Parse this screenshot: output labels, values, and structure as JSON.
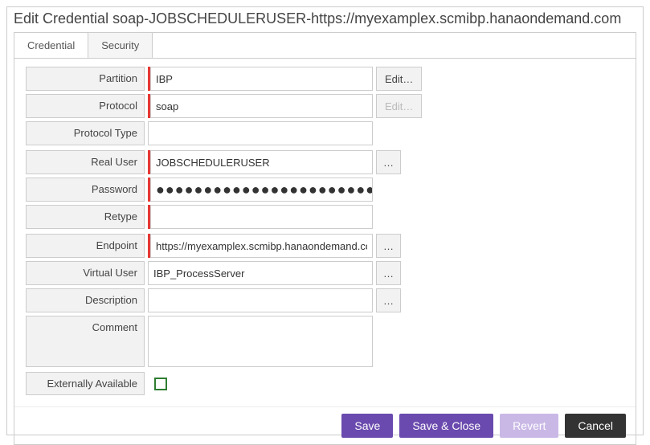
{
  "title": "Edit Credential soap-JOBSCHEDULERUSER-https://myexamplex.scmibp.hanaondemand.com",
  "tabs": {
    "credential": "Credential",
    "security": "Security"
  },
  "labels": {
    "partition": "Partition",
    "protocol": "Protocol",
    "protocolType": "Protocol Type",
    "realUser": "Real User",
    "password": "Password",
    "retype": "Retype",
    "endpoint": "Endpoint",
    "virtualUser": "Virtual User",
    "description": "Description",
    "comment": "Comment",
    "externallyAvailable": "Externally Available"
  },
  "fields": {
    "partition": "IBP",
    "protocol": "soap",
    "protocolType": "",
    "realUser": "JOBSCHEDULERUSER",
    "password": "●●●●●●●●●●●●●●●●●●●●●●●●●●●●●●●●",
    "retype": "",
    "endpoint": "https://myexamplex.scmibp.hanaondemand.com",
    "virtualUser": "IBP_ProcessServer",
    "description": "",
    "comment": "",
    "externallyAvailable": false
  },
  "buttons": {
    "edit": "Edit…",
    "ellipsis": "…",
    "save": "Save",
    "saveClose": "Save & Close",
    "revert": "Revert",
    "cancel": "Cancel"
  }
}
